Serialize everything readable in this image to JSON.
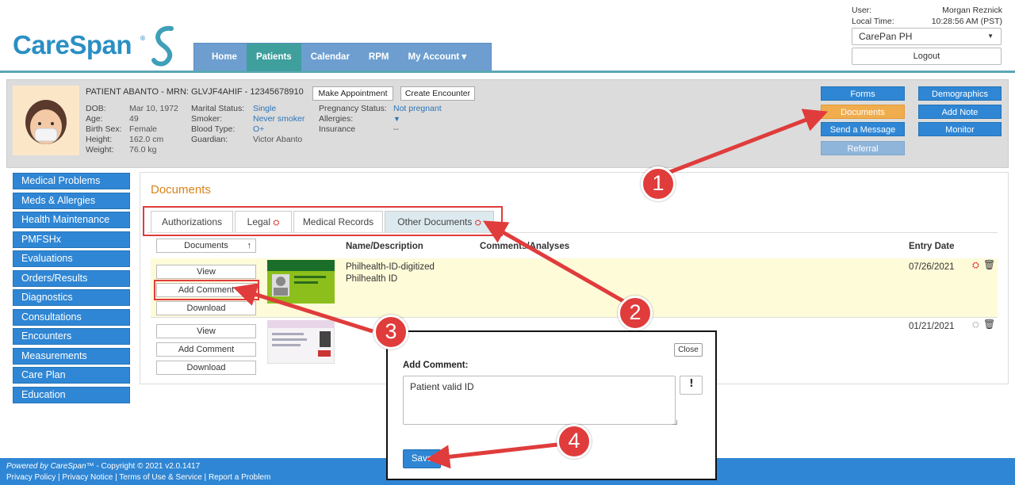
{
  "brand": {
    "name": "CareSpan",
    "mark": "®"
  },
  "nav": {
    "items": [
      "Home",
      "Patients",
      "Calendar",
      "RPM",
      "My Account ▾"
    ],
    "active": "Patients"
  },
  "user": {
    "user_label": "User:",
    "user_name": "Morgan Reznick",
    "time_label": "Local Time:",
    "time_value": "10:28:56 AM (PST)",
    "practice": "CarePan PH",
    "logout": "Logout"
  },
  "patient": {
    "header": "PATIENT ABANTO - MRN: GLVJF4AHIF - 12345678910",
    "make_appointment": "Make Appointment",
    "create_encounter": "Create Encounter",
    "col1": {
      "labels": [
        "DOB:",
        "Age:",
        "Birth Sex:",
        "Height:",
        "Weight:"
      ],
      "values": [
        "Mar 10, 1972",
        "49",
        "Female",
        "162.0 cm",
        "76.0 kg"
      ]
    },
    "col2": {
      "labels": [
        "Marital Status:",
        "Smoker:",
        "Blood Type:",
        "Guardian:"
      ],
      "values": [
        "Single",
        "Never smoker",
        "O+",
        "Victor Abanto"
      ]
    },
    "col3": {
      "labels": [
        "Pregnancy Status:",
        "Allergies:",
        "Insurance"
      ],
      "values": [
        "Not pregnant",
        "",
        "--"
      ]
    },
    "actions_left": [
      "Forms",
      "Documents",
      "Send a Message",
      "Referral"
    ],
    "actions_right": [
      "Demographics",
      "Add Note",
      "Monitor"
    ]
  },
  "sidebar": {
    "items": [
      "Medical Problems",
      "Meds & Allergies",
      "Health Maintenance",
      "PMFSHx",
      "Evaluations",
      "Orders/Results",
      "Diagnostics",
      "Consultations",
      "Encounters",
      "Measurements",
      "Care Plan",
      "Education"
    ]
  },
  "documents": {
    "title": "Documents",
    "tabs": [
      "Authorizations",
      "Legal",
      "Medical Records",
      "Other Documents"
    ],
    "sort_label": "Documents",
    "columns": {
      "name": "Name/Description",
      "comments": "Comments/Analyses",
      "entry": "Entry Date"
    },
    "row_buttons": {
      "view": "View",
      "add_comment": "Add Comment",
      "download": "Download"
    },
    "rows": [
      {
        "name": "Philhealth-ID-digitized",
        "description": "Philhealth ID",
        "entry_date": "07/26/2021"
      },
      {
        "name": "",
        "description": "",
        "entry_date": "01/21/2021"
      }
    ]
  },
  "dialog": {
    "close": "Close",
    "label": "Add Comment:",
    "value": "Patient valid ID",
    "save": "Save"
  },
  "callouts": [
    "1",
    "2",
    "3",
    "4"
  ],
  "footer": {
    "powered": "Powered by CareSpan™",
    "copyright": " - Copyright © 2021 v2.0.1417",
    "links": [
      "Privacy Policy",
      "Privacy Notice",
      "Terms of Use & Service",
      "Report a Problem"
    ]
  },
  "colors": {
    "primary": "#2f86d4",
    "accent_orange": "#f0ad4e",
    "teal": "#3f9f9d",
    "callout_red": "#e03c3c",
    "row_highlight": "#fefbd9"
  }
}
